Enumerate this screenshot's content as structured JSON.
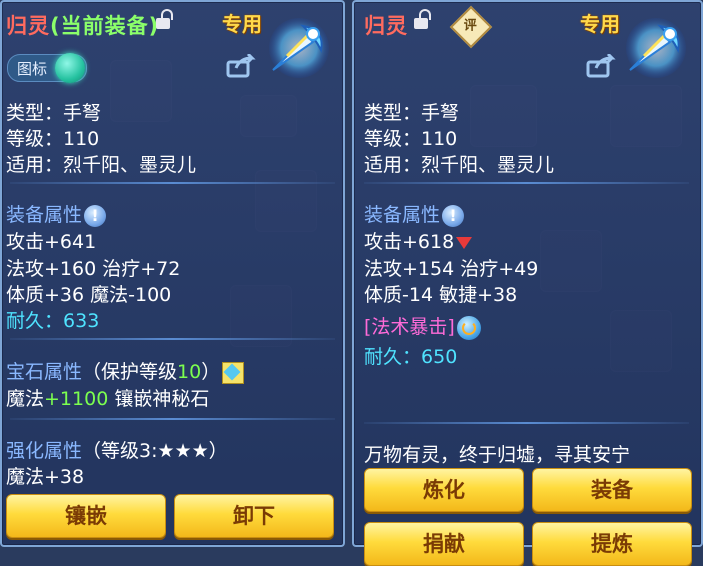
{
  "left": {
    "title": "归灵",
    "title_equipped": "(当前装备)",
    "exclusive_label": "专用",
    "toggle_label": "图标",
    "basic": {
      "type": "类型：手弩",
      "level": "等级：110",
      "usable_by": "适用：烈千阳、墨灵儿"
    },
    "equip_attr_heading": "装备属性",
    "attrs": [
      "攻击+641",
      "法攻+160 治疗+72",
      "体质+36 魔法-100"
    ],
    "durability_label": "耐久：",
    "durability_value": "633",
    "gem_heading": "宝石属性",
    "gem_protect_prefix": "（保护等级",
    "gem_protect_level": "10",
    "gem_protect_suffix": "）",
    "gem_stat_prefix": "魔法",
    "gem_stat_value": "+1100",
    "gem_stat_suffix": " 镶嵌神秘石",
    "enhance_heading": "强化属性",
    "enhance_detail": "（等级3:★★★）",
    "enhance_stat": "魔法+38",
    "buttons": [
      "镶嵌",
      "卸下"
    ]
  },
  "right": {
    "title": "归灵",
    "rating_label": "评",
    "exclusive_label": "专用",
    "basic": {
      "type": "类型：手弩",
      "level": "等级：110",
      "usable_by": "适用：烈千阳、墨灵儿"
    },
    "equip_attr_heading": "装备属性",
    "attack": "攻击+618",
    "attrs": [
      "法攻+154 治疗+49",
      "体质-14 敏捷+38"
    ],
    "special": "[法术暴击]",
    "durability_label": "耐久：",
    "durability_value": "650",
    "flavor": "万物有灵，终于归墟，寻其安宁",
    "buttons": [
      "炼化",
      "装备",
      "捐献",
      "提炼"
    ]
  },
  "colors": {
    "title_red": "#ff6b5f",
    "equipped_green": "#8bff6a",
    "exclusive_gold": "#ffd94a",
    "section_blue": "#8ab8ff",
    "durability_cyan": "#4fe3ff",
    "gem_green": "#7cff4f",
    "special_magenta": "#ff6bd8",
    "button_gold": "#ffdb3c"
  },
  "icons": [
    "lock-icon",
    "share-icon",
    "info-icon",
    "gem-icon",
    "down-arrow-icon",
    "refresh-icon",
    "rating-icon",
    "item-icon"
  ]
}
